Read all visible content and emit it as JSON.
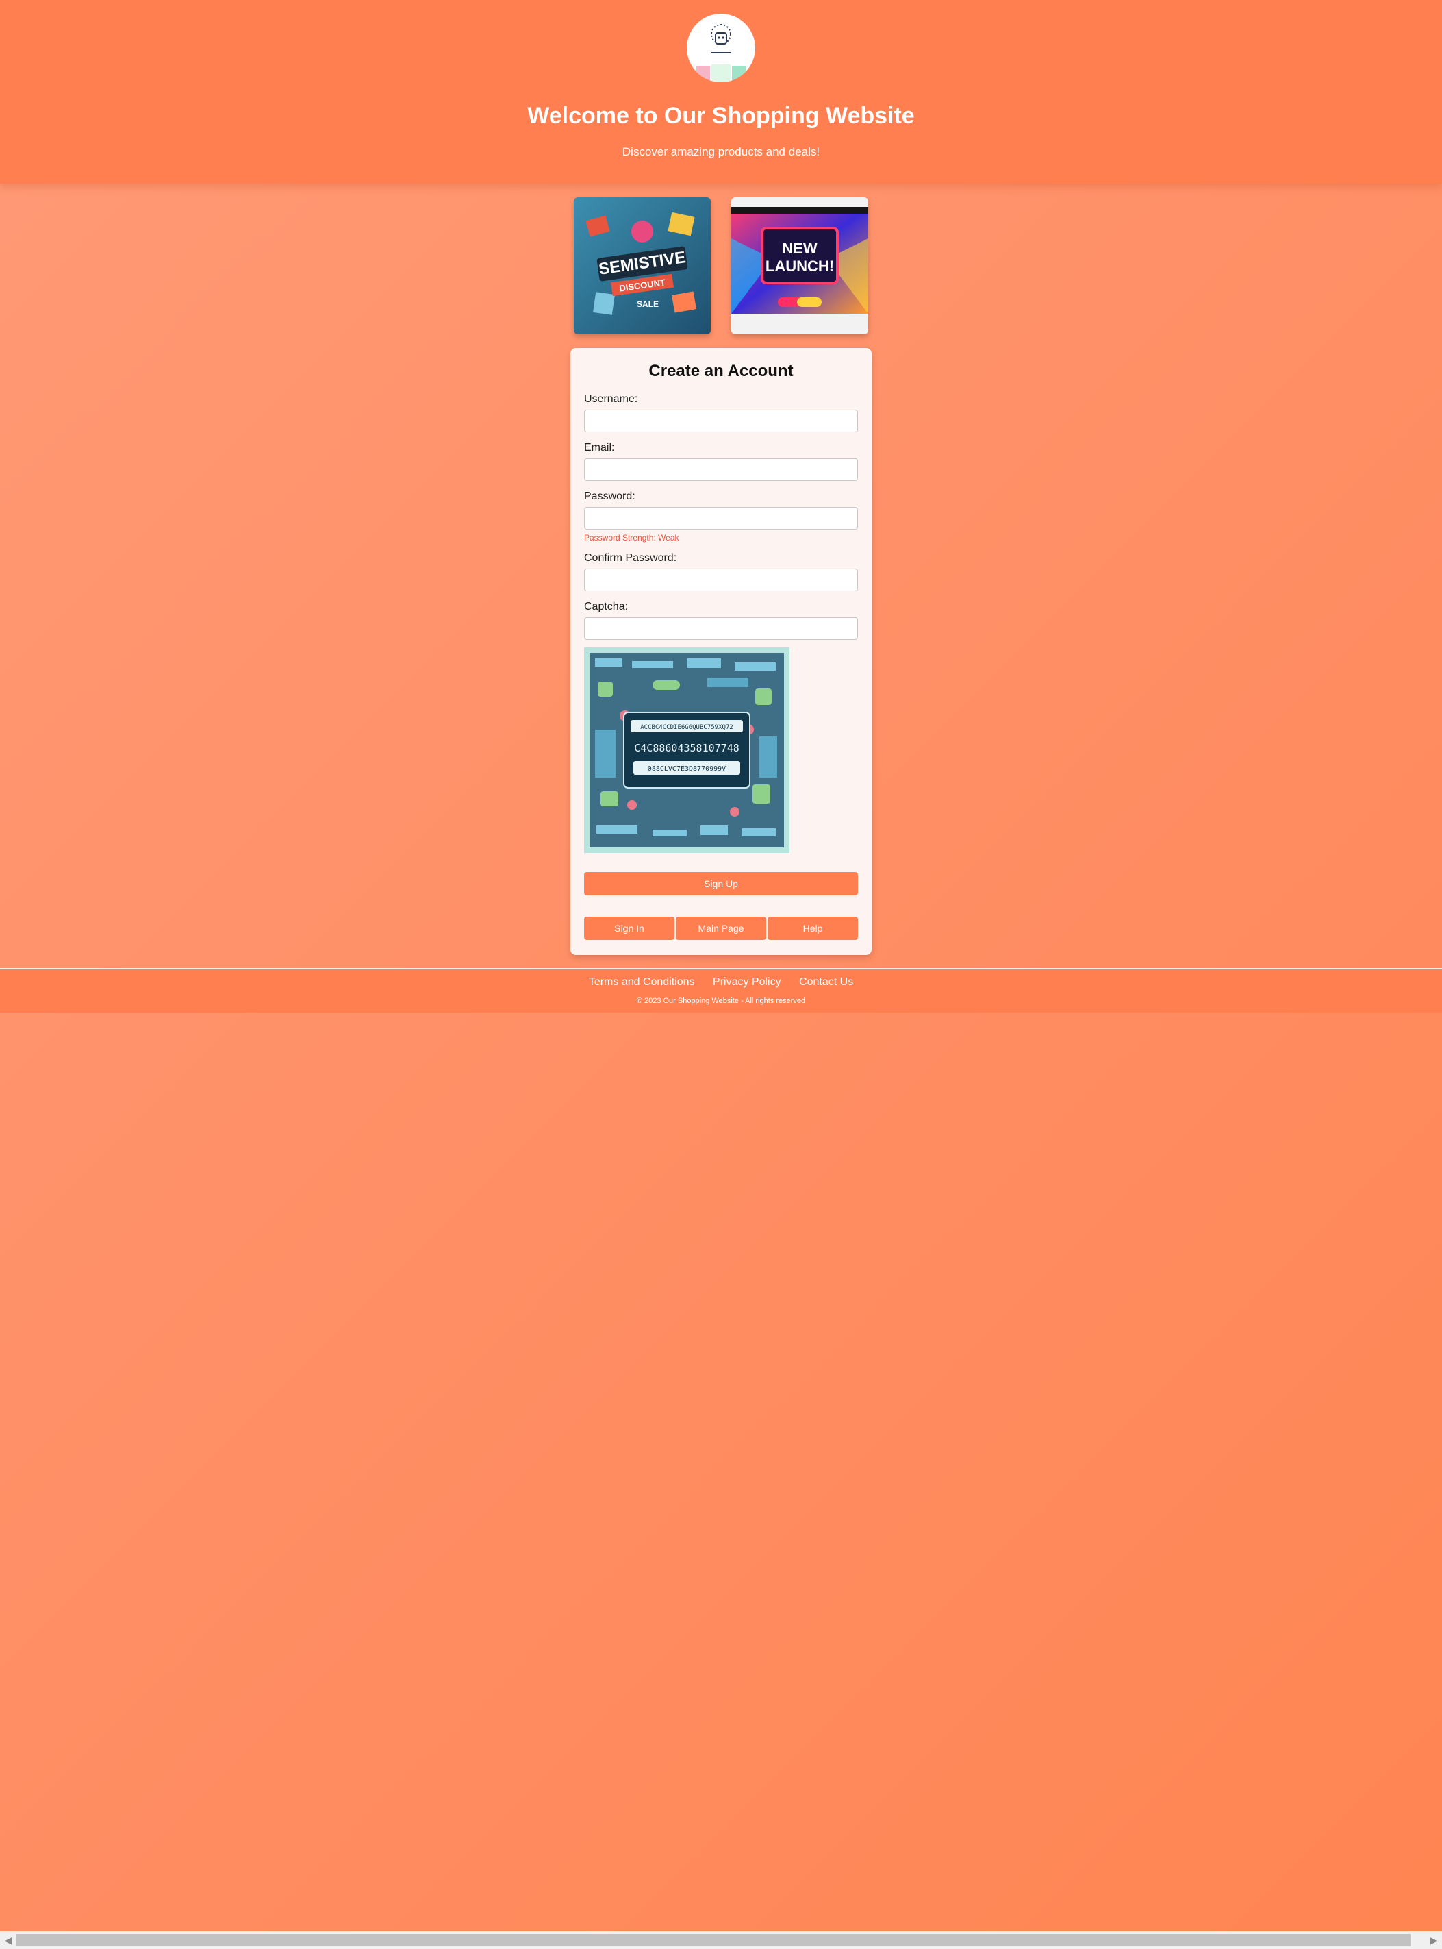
{
  "header": {
    "title": "Welcome to Our Shopping Website",
    "subtitle": "Discover amazing products and deals!"
  },
  "promos": [
    {
      "image": "discount-sale-banner"
    },
    {
      "image": "new-launch-banner"
    }
  ],
  "form": {
    "title": "Create an Account",
    "username_label": "Username:",
    "username_value": "",
    "email_label": "Email:",
    "email_value": "",
    "password_label": "Password:",
    "password_value": "",
    "password_strength": "Password Strength: Weak",
    "confirm_label": "Confirm Password:",
    "confirm_value": "",
    "captcha_label": "Captcha:",
    "captcha_value": "",
    "captcha_lines": [
      "ACCBC4CCDIE6G6QUBC759XQ72",
      "C4C88604358107748",
      "088CLVC7E3D8770999V"
    ],
    "signup_label": "Sign Up",
    "signin_label": "Sign In",
    "mainpage_label": "Main Page",
    "help_label": "Help"
  },
  "footer": {
    "links": [
      "Terms and Conditions",
      "Privacy Policy",
      "Contact Us"
    ],
    "copyright": "© 2023 Our Shopping Website - All rights reserved"
  },
  "colors": {
    "accent": "#ff7f50",
    "background": "#ff9a76",
    "card": "#fdf3f0",
    "warning": "#e8553e"
  }
}
